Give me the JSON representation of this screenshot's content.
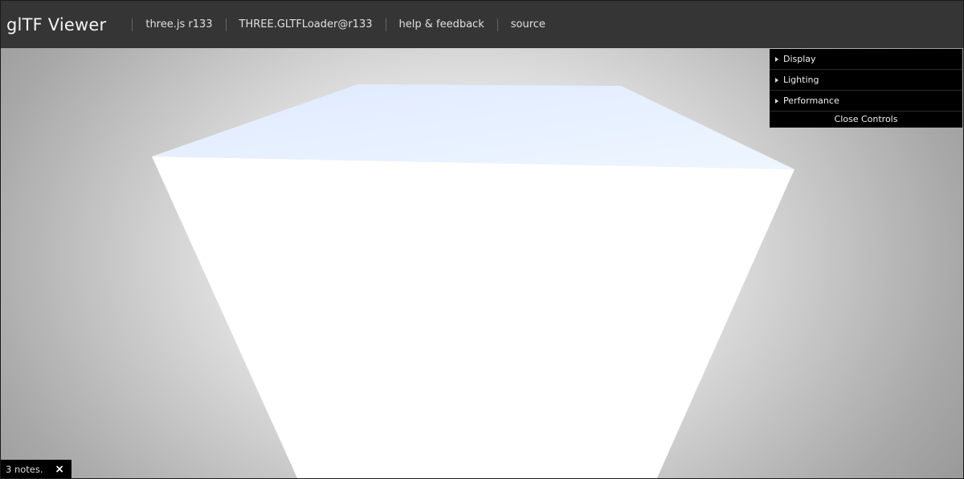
{
  "header": {
    "title": "glTF Viewer",
    "nav": [
      {
        "label": "three.js r133"
      },
      {
        "label": "THREE.GLTFLoader@r133"
      },
      {
        "label": "help & feedback"
      },
      {
        "label": "source"
      }
    ]
  },
  "controls": {
    "folders": [
      {
        "label": "Display"
      },
      {
        "label": "Lighting"
      },
      {
        "label": "Performance"
      }
    ],
    "close_label": "Close Controls"
  },
  "notes": {
    "label": "3 notes.",
    "close_glyph": "×"
  },
  "icons": {
    "folder_toggle": "triangle-right-icon",
    "notes_close": "close-icon"
  },
  "colors": {
    "header_bg": "#353535",
    "controls_bg": "#000000",
    "model_top": "#e6f0ff",
    "model_front": "#ffffff"
  }
}
